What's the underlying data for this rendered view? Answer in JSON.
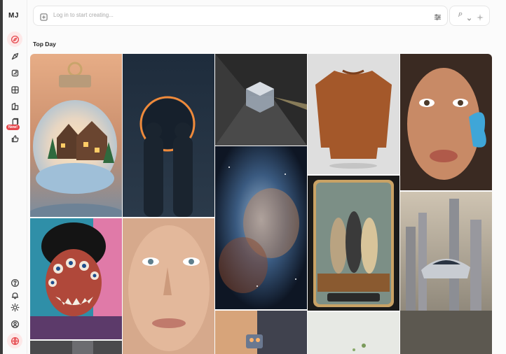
{
  "app": {
    "logo": "MJ"
  },
  "sidebar": {
    "items": [
      {
        "name": "explore",
        "icon": "compass-icon",
        "active": true
      },
      {
        "name": "create",
        "icon": "brush-icon"
      },
      {
        "name": "edit",
        "icon": "image-edit-icon"
      },
      {
        "name": "organize",
        "icon": "grid-icon"
      },
      {
        "name": "personalize",
        "icon": "palette-icon"
      },
      {
        "name": "moodboards",
        "icon": "cards-icon",
        "badge": "New!"
      },
      {
        "name": "likes",
        "icon": "thumbs-up-icon"
      }
    ],
    "bottom": [
      {
        "name": "help",
        "icon": "question-icon"
      },
      {
        "name": "notifications",
        "icon": "bell-icon"
      },
      {
        "name": "theme",
        "icon": "sun-icon"
      },
      {
        "name": "account",
        "icon": "user-circle-icon"
      },
      {
        "name": "language",
        "icon": "globe-icon"
      }
    ]
  },
  "search": {
    "placeholder": "Log in to start creating..."
  },
  "mode": {
    "letter": "P"
  },
  "section": {
    "title": "Top Day"
  },
  "gallery": [
    {
      "name": "snow-globe-ornament"
    },
    {
      "name": "eclipse-silhouettes"
    },
    {
      "name": "glass-cube-prism"
    },
    {
      "name": "brown-knit-sweater"
    },
    {
      "name": "woman-butterfly-portrait"
    },
    {
      "name": "eyeball-monster-mask"
    },
    {
      "name": "nebula-space"
    },
    {
      "name": "tarot-three-women"
    },
    {
      "name": "elderly-woman-portrait"
    },
    {
      "name": "futuristic-city-car"
    },
    {
      "name": "dark-street-scene"
    },
    {
      "name": "robot-sunset"
    },
    {
      "name": "misty-green-scene"
    }
  ]
}
